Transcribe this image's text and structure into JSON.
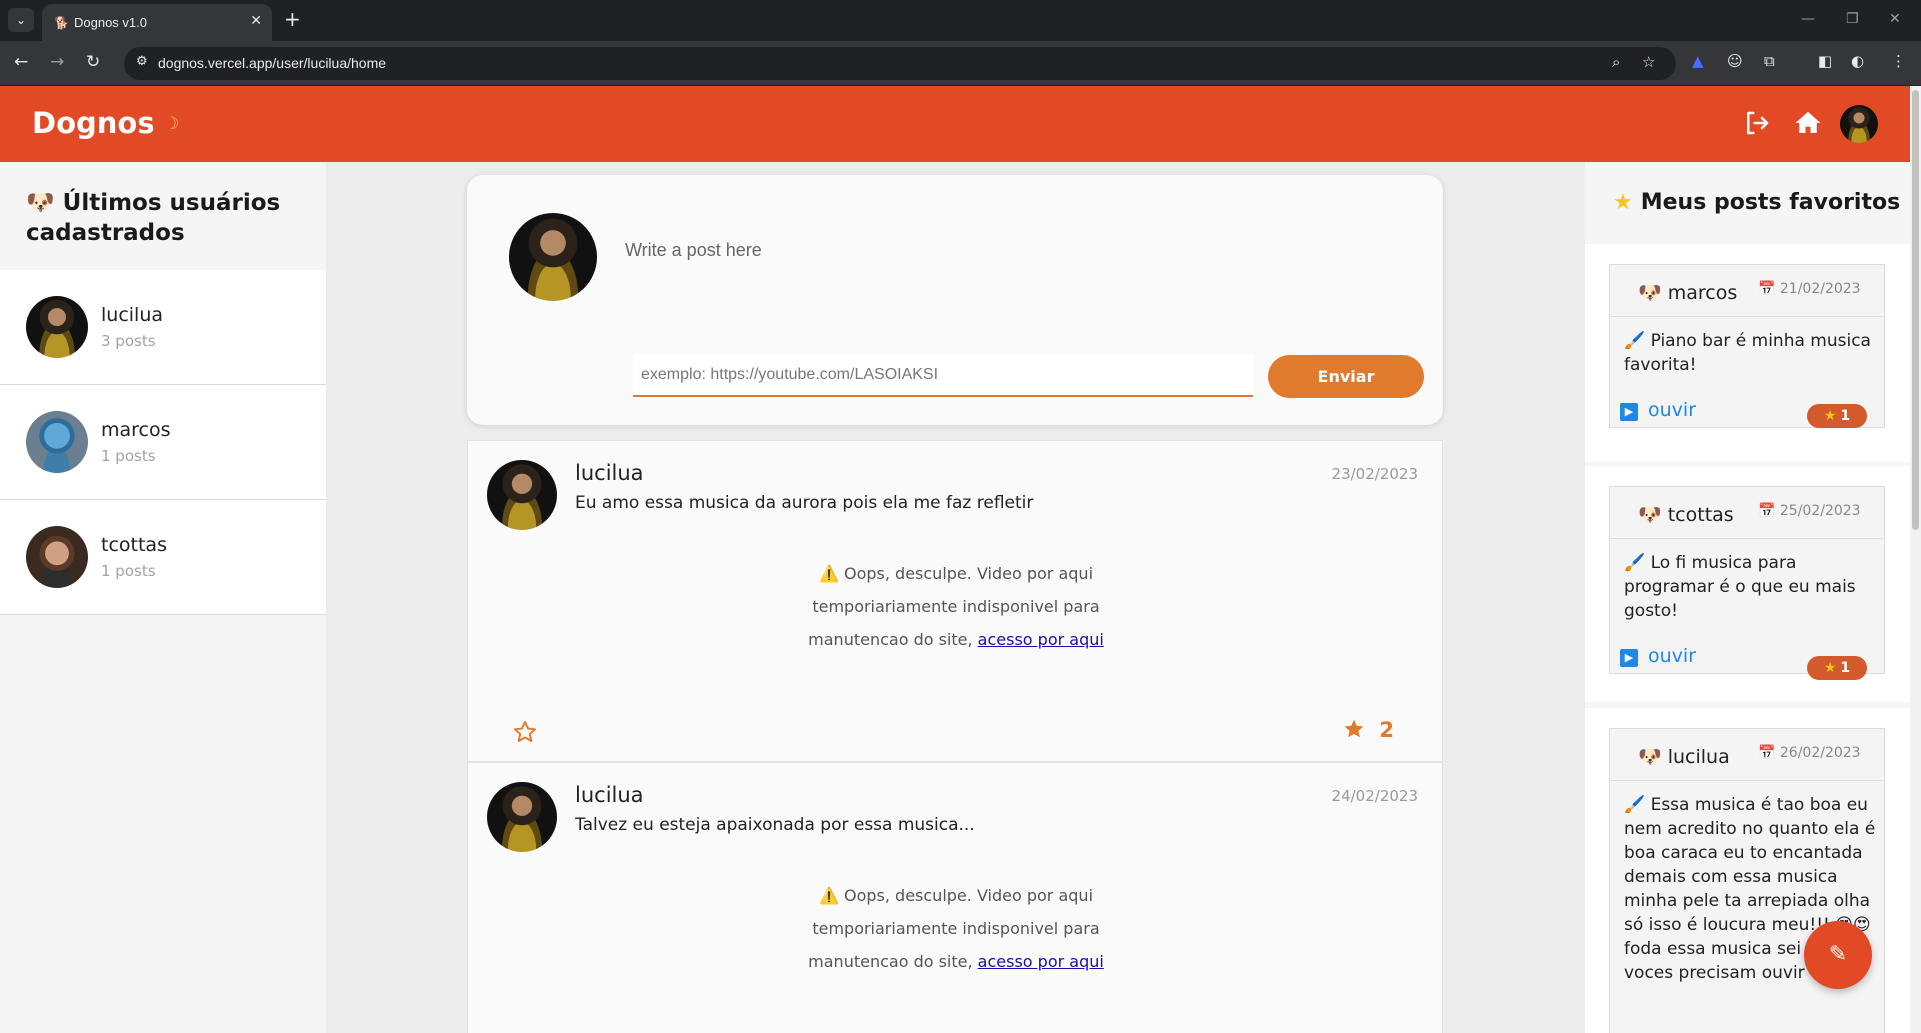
{
  "browser": {
    "tab_title": "Dognos v1.0",
    "new_tab": "+",
    "url": "dognos.vercel.app/user/lucilua/home"
  },
  "header": {
    "logo": "Dognos",
    "moon_icon": "☽",
    "accent": "#e24a26"
  },
  "sidebar_left": {
    "title": "Últimos usuários cadastrados",
    "users": [
      {
        "name": "lucilua",
        "posts": "3 posts"
      },
      {
        "name": "marcos",
        "posts": "1 posts"
      },
      {
        "name": "tcottas",
        "posts": "1 posts"
      }
    ]
  },
  "composer": {
    "text_placeholder": "Write a post here",
    "link_placeholder": "exemplo: https://youtube.com/LASOIAKSI",
    "send_label": "Enviar",
    "button_color": "#e07b2e"
  },
  "feed": {
    "posts": [
      {
        "user": "lucilua",
        "date": "23/02/2023",
        "text": "Eu amo essa musica da aurora pois ela me faz refletir",
        "notice_l1": "Oops, desculpe. Video por aqui",
        "notice_l2": "temporiariamente indisponivel para",
        "notice_l3": "manutencao do site,",
        "notice_link": "acesso por aqui",
        "likes": "2"
      },
      {
        "user": "lucilua",
        "date": "24/02/2023",
        "text": "Talvez eu esteja apaixonada por essa musica...",
        "notice_l1": "Oops, desculpe. Video por aqui",
        "notice_l2": "temporiariamente indisponivel para",
        "notice_l3": "manutencao do site,",
        "notice_link": "acesso por aqui"
      }
    ]
  },
  "sidebar_right": {
    "title": "Meus posts favoritos",
    "favorites": [
      {
        "author": "marcos",
        "date": "21/02/2023",
        "text": "Piano bar é minha musica favorita!",
        "listen": "ouvir",
        "count": "1"
      },
      {
        "author": "tcottas",
        "date": "25/02/2023",
        "text": "Lo fi musica para programar é o que eu mais gosto!",
        "listen": "ouvir",
        "count": "1"
      },
      {
        "author": "lucilua",
        "date": "26/02/2023",
        "text": "Essa musica é tao boa eu nem acredito no quanto ela é boa caraca eu to encantada demais com essa musica minha pele ta arrepiada olha só isso é loucura meu!!! 😍😍 foda essa musica sei galera voces precisam ouvir"
      }
    ]
  },
  "icons": {
    "dog": "🐶",
    "star": "★",
    "warning": "⚠️",
    "brush": "🖌️",
    "calendar": "📅",
    "pencil": "✎"
  }
}
